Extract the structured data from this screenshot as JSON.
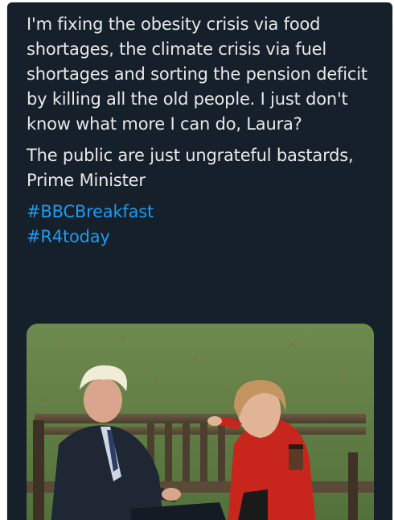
{
  "tweet": {
    "paragraph_1": "I'm fixing the obesity crisis via food shortages, the climate crisis via fuel shortages and sorting the pension deficit by killing all the old people. I just don't know what more I can do, Laura?",
    "paragraph_2": "The public are just ungrateful bastards, Prime Minister",
    "hashtags": [
      "#BBCBreakfast",
      "#R4today"
    ]
  },
  "colors": {
    "background": "#15202b",
    "text": "#e7e9ea",
    "link": "#1d9bf0"
  }
}
